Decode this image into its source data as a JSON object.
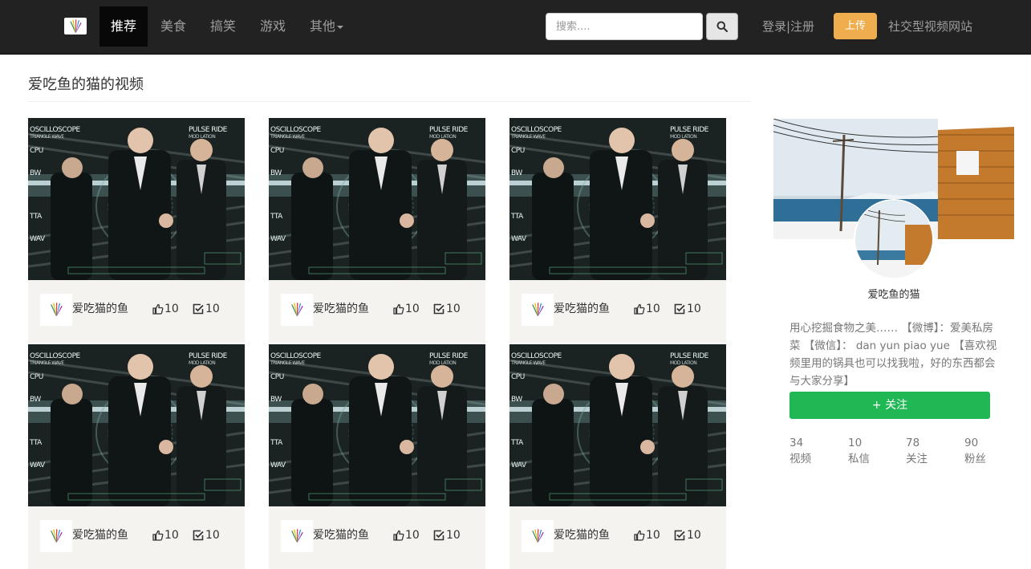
{
  "nav": {
    "items": [
      {
        "label": "推荐",
        "active": true
      },
      {
        "label": "美食",
        "active": false
      },
      {
        "label": "搞笑",
        "active": false
      },
      {
        "label": "游戏",
        "active": false
      },
      {
        "label": "其他",
        "active": false,
        "dropdown": true
      }
    ],
    "search_placeholder": "搜索....",
    "search_icon": "search-icon",
    "login_label": "登录|注册",
    "upload_label": "上传",
    "site_name": "社交型视频网站"
  },
  "section": {
    "title": "爱吃鱼的猫的视频"
  },
  "videos": [
    {
      "author": "爱吃猫的鱼",
      "likes": "10",
      "comments": "10"
    },
    {
      "author": "爱吃猫的鱼",
      "likes": "10",
      "comments": "10"
    },
    {
      "author": "爱吃猫的鱼",
      "likes": "10",
      "comments": "10"
    },
    {
      "author": "爱吃猫的鱼",
      "likes": "10",
      "comments": "10"
    },
    {
      "author": "爱吃猫的鱼",
      "likes": "10",
      "comments": "10"
    },
    {
      "author": "爱吃猫的鱼",
      "likes": "10",
      "comments": "10"
    }
  ],
  "thumbnail_text": {
    "top_left": "OSCILLOSCOPE",
    "top_left_sub": "TRIANGLE WAVE",
    "top_right": "PULSE RIDE",
    "top_right_sub": "MOD LATION",
    "left_labels": [
      "CPU",
      "BW",
      "TTA",
      "WAV"
    ]
  },
  "profile": {
    "name": "爱吃鱼的猫",
    "bio": "用心挖掘食物之美…… 【微博】：爱美私房菜 【微信】： dan yun piao yue 【喜欢视频里用的锅具也可以找我啦，好的东西都会与大家分享】",
    "follow_label": "+   关注",
    "stats": [
      {
        "value": "34",
        "label": "视频"
      },
      {
        "value": "10",
        "label": "私信"
      },
      {
        "value": "78",
        "label": "关注"
      },
      {
        "value": "90",
        "label": "粉丝"
      }
    ]
  },
  "colors": {
    "navbar": "#222222",
    "nav_active": "#080808",
    "upload": "#f0ad4e",
    "follow": "#1fb855",
    "card_bg": "#f5f3ef"
  }
}
